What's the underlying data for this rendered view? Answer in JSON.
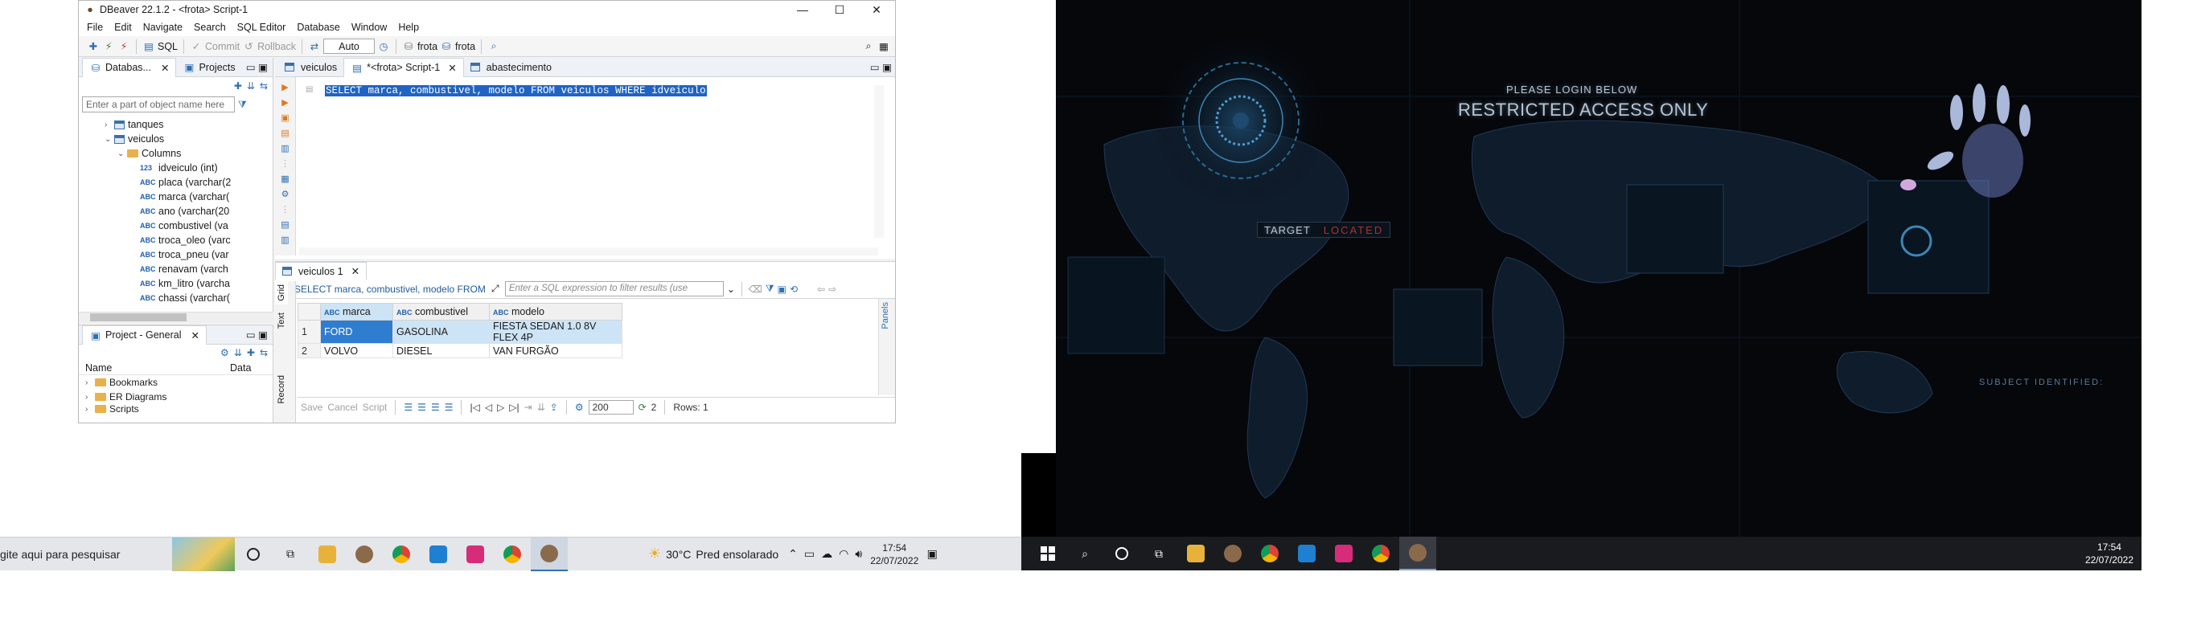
{
  "dbeaver": {
    "title": "DBeaver 22.1.2 - <frota> Script-1",
    "window_controls": {
      "minimize": "—",
      "maximize": "☐",
      "close": "✕"
    },
    "menu": [
      "File",
      "Edit",
      "Navigate",
      "Search",
      "SQL Editor",
      "Database",
      "Window",
      "Help"
    ],
    "toolbar": {
      "sql": "SQL",
      "commit": "Commit",
      "rollback": "Rollback",
      "mode": "Auto",
      "datasource": "frota",
      "schema": "frota"
    },
    "nav": {
      "tabs": [
        "Databas...",
        "Projects"
      ],
      "filter_placeholder": "Enter a part of object name here",
      "tree": [
        {
          "label": "tanques",
          "kind": "table",
          "indent": 2,
          "caret": "›"
        },
        {
          "label": "veiculos",
          "kind": "table",
          "indent": 2,
          "caret": "⌄"
        },
        {
          "label": "Columns",
          "kind": "folder",
          "indent": 3,
          "caret": "⌄"
        },
        {
          "label": "idveiculo (int)",
          "kind": "col-int",
          "indent": 4,
          "caret": ""
        },
        {
          "label": "placa (varchar(2",
          "kind": "col",
          "indent": 4,
          "caret": ""
        },
        {
          "label": "marca (varchar(",
          "kind": "col",
          "indent": 4,
          "caret": ""
        },
        {
          "label": "ano (varchar(20",
          "kind": "col",
          "indent": 4,
          "caret": ""
        },
        {
          "label": "combustivel (va",
          "kind": "col",
          "indent": 4,
          "caret": ""
        },
        {
          "label": "troca_oleo (varc",
          "kind": "col",
          "indent": 4,
          "caret": ""
        },
        {
          "label": "troca_pneu (var",
          "kind": "col",
          "indent": 4,
          "caret": ""
        },
        {
          "label": "renavam (varch",
          "kind": "col",
          "indent": 4,
          "caret": ""
        },
        {
          "label": "km_litro (varcha",
          "kind": "col",
          "indent": 4,
          "caret": ""
        },
        {
          "label": "chassi (varchar(",
          "kind": "col",
          "indent": 4,
          "caret": ""
        }
      ]
    },
    "project": {
      "tab": "Project - General",
      "col_name": "Name",
      "col_data": "Data",
      "items": [
        "Bookmarks",
        "ER Diagrams",
        "Scripts"
      ]
    },
    "editor": {
      "tabs": [
        "veiculos",
        "*<frota> Script-1",
        "abastecimento"
      ],
      "sql": "SELECT marca, combustivel, modelo FROM veiculos WHERE idveiculo"
    },
    "results": {
      "tab": "veiculos 1",
      "query": "SELECT marca, combustivel, modelo FROM",
      "filter_placeholder": "Enter a SQL expression to filter results (use",
      "side_tabs": [
        "Grid",
        "Text",
        "Record"
      ],
      "panels_label": "Panels",
      "columns": [
        "marca",
        "combustivel",
        "modelo"
      ],
      "rows": [
        [
          "1",
          "FORD",
          "GASOLINA",
          "FIESTA SEDAN 1.0 8V FLEX 4P"
        ],
        [
          "2",
          "VOLVO",
          "DIESEL",
          "VAN FURGÃO"
        ]
      ],
      "bar": {
        "save": "Save",
        "cancel": "Cancel",
        "script": "Script",
        "fetch": "200",
        "count": "2",
        "rows": "Rows: 1"
      }
    }
  },
  "login": {
    "line1": "PLEASE LOGIN BELOW",
    "line2": "RESTRICTED ACCESS ONLY",
    "target": "TARGET",
    "located": "LOCATED",
    "subject": "SUBJECT IDENTIFIED:"
  },
  "taskbar1": {
    "search_text": "gite aqui para pesquisar",
    "weather_temp": "30°C",
    "weather_text": "Pred ensolarado",
    "time": "17:54",
    "date": "22/07/2022"
  },
  "taskbar2": {
    "time": "17:54",
    "date": "22/07/2022"
  }
}
